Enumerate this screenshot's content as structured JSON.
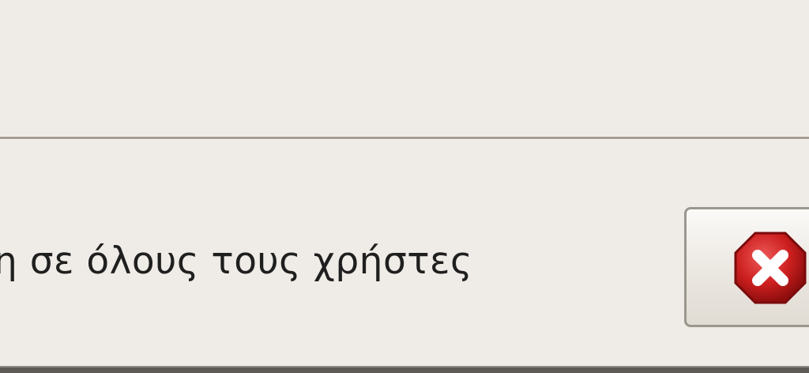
{
  "dialog": {
    "option_label": "η σε όλους τους χρήστες",
    "cancel_icon": "cancel-icon"
  },
  "colors": {
    "background": "#efebe6",
    "separator": "#a39d94",
    "icon_red": "#cc1f1f",
    "text": "#1f1f1f"
  }
}
